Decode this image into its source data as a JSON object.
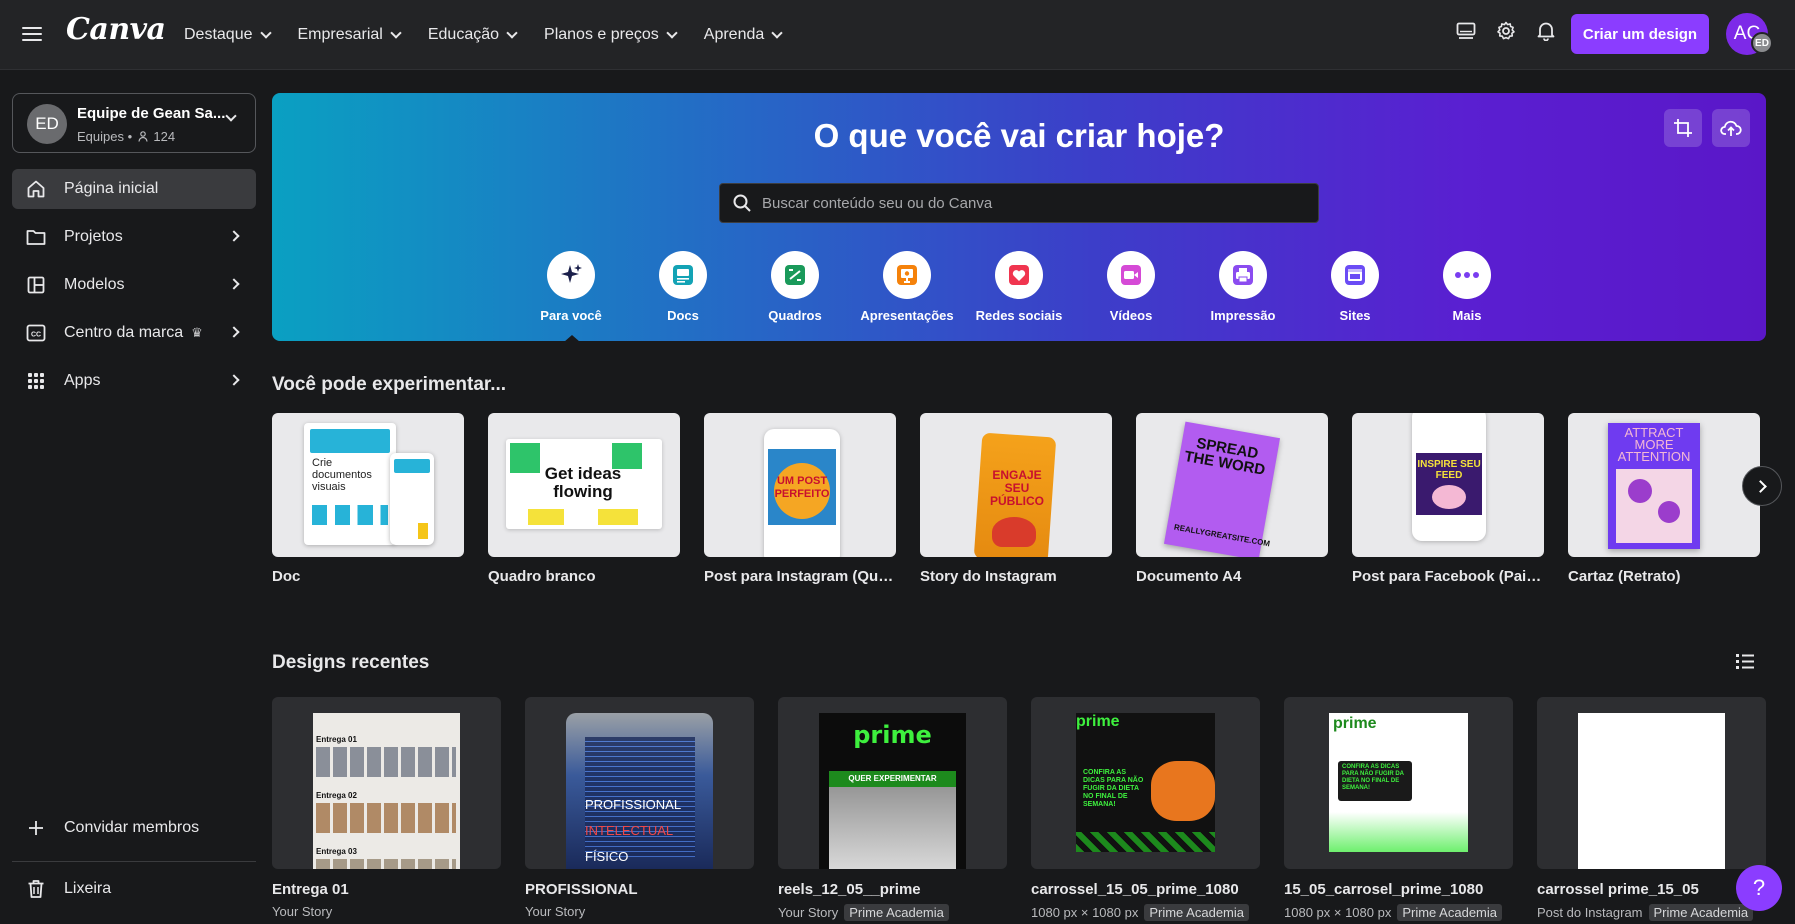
{
  "colors": {
    "accent": "#8b3dff",
    "background": "#18191b",
    "topbar": "#232426"
  },
  "header": {
    "logo": "Canva",
    "nav": [
      "Destaque",
      "Empresarial",
      "Educação",
      "Planos e preços",
      "Aprenda"
    ],
    "create_label": "Criar um design",
    "avatar_initials": "AC",
    "avatar_badge": "ED"
  },
  "sidebar": {
    "team": {
      "initials": "ED",
      "name": "Equipe de Gean Sa...",
      "type": "Equipes",
      "members": "124"
    },
    "items": [
      {
        "label": "Página inicial",
        "icon": "home-icon",
        "active": true
      },
      {
        "label": "Projetos",
        "icon": "folder-icon"
      },
      {
        "label": "Modelos",
        "icon": "layout-icon"
      },
      {
        "label": "Centro da marca",
        "icon": "brand-icon"
      },
      {
        "label": "Apps",
        "icon": "apps-grid-icon"
      }
    ],
    "invite_label": "Convidar membros",
    "trash_label": "Lixeira"
  },
  "hero": {
    "title": "O que você vai criar hoje?",
    "search_placeholder": "Buscar conteúdo seu ou do Canva",
    "categories": [
      {
        "label": "Para você",
        "icon": "sparkle-icon",
        "color": "#1a1f4a"
      },
      {
        "label": "Docs",
        "icon": "doc-icon",
        "color": "#13a3b5"
      },
      {
        "label": "Quadros",
        "icon": "whiteboard-icon",
        "color": "#1a9a5a"
      },
      {
        "label": "Apresentações",
        "icon": "presentation-icon",
        "color": "#f5820b"
      },
      {
        "label": "Redes sociais",
        "icon": "heart-icon",
        "color": "#f0354f"
      },
      {
        "label": "Vídeos",
        "icon": "video-icon",
        "color": "#d54ad6"
      },
      {
        "label": "Impressão",
        "icon": "print-icon",
        "color": "#8b4cf0"
      },
      {
        "label": "Sites",
        "icon": "site-icon",
        "color": "#6b4cf5"
      },
      {
        "label": "Mais",
        "icon": "more-icon",
        "color": "#7a3df0"
      }
    ]
  },
  "suggestions": {
    "title": "Você pode experimentar...",
    "items": [
      {
        "label": "Doc"
      },
      {
        "label": "Quadro branco"
      },
      {
        "label": "Post para Instagram (Quadrado)"
      },
      {
        "label": "Story do Instagram"
      },
      {
        "label": "Documento A4"
      },
      {
        "label": "Post para Facebook (Paisagem)"
      },
      {
        "label": "Cartaz (Retrato)"
      }
    ],
    "thumb_text": {
      "doc": "Crie documentos visuais",
      "board": "Get ideas flowing",
      "insta": "UM POST PERFEITO",
      "story": "ENGAJE SEU PÚBLICO",
      "a4": "SPREAD THE WORD",
      "a4_site": "REALLYGREATSITE.COM",
      "fb": "INSPIRE SEU FEED",
      "poster": "ATTRACT MORE ATTENTION"
    }
  },
  "recent": {
    "title": "Designs recentes",
    "items": [
      {
        "title": "Entrega 01",
        "meta": "Your Story",
        "tag": ""
      },
      {
        "title": "PROFISSIONAL",
        "meta": "Your Story",
        "tag": ""
      },
      {
        "title": "reels_12_05__prime",
        "meta": "Your Story",
        "tag": "Prime Academia"
      },
      {
        "title": "carrossel_15_05_prime_1080",
        "meta": "1080 px × 1080 px",
        "tag": "Prime Academia"
      },
      {
        "title": "15_05_carrosel_prime_1080",
        "meta": "1080 px × 1080 px",
        "tag": "Prime Academia"
      },
      {
        "title": "carrossel prime_15_05",
        "meta": "Post do Instagram",
        "tag": "Prime Academia"
      }
    ],
    "thumb_text": {
      "entrega_rows": [
        "Entrega 01",
        "Entrega 02",
        "Entrega 03"
      ],
      "prof_lines": [
        "PROFISSIONAL",
        "INTELECTUAL",
        "FÍSICO"
      ],
      "prime": "prime",
      "quer": "QUER EXPERIMENTAR",
      "dicas": "CONFIRA AS DICAS PARA NÃO FUGIR DA DIETA NO FINAL DE SEMANA!"
    }
  },
  "help_label": "?"
}
